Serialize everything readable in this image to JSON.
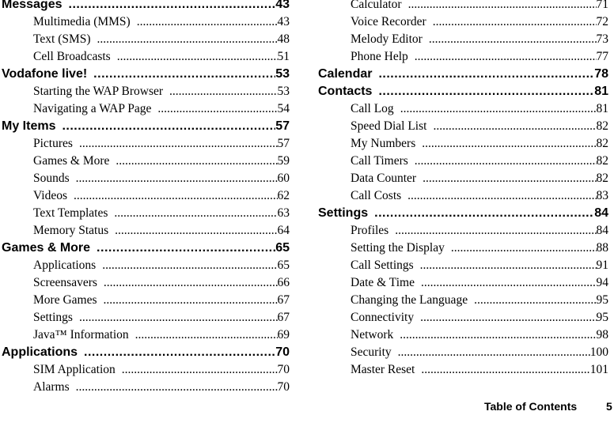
{
  "left_column": [
    {
      "type": "heading",
      "label": "Messages",
      "page": "43"
    },
    {
      "type": "sub",
      "label": "Multimedia (MMS)",
      "page": "43"
    },
    {
      "type": "sub",
      "label": "Text (SMS)",
      "page": "48"
    },
    {
      "type": "sub",
      "label": "Cell Broadcasts",
      "page": "51"
    },
    {
      "type": "heading",
      "label": "Vodafone live!",
      "page": "53"
    },
    {
      "type": "sub",
      "label": "Starting the WAP Browser",
      "page": "53"
    },
    {
      "type": "sub",
      "label": "Navigating a WAP Page",
      "page": "54"
    },
    {
      "type": "heading",
      "label": "My Items",
      "page": "57"
    },
    {
      "type": "sub",
      "label": "Pictures",
      "page": "57"
    },
    {
      "type": "sub",
      "label": "Games & More",
      "page": "59"
    },
    {
      "type": "sub",
      "label": "Sounds",
      "page": "60"
    },
    {
      "type": "sub",
      "label": "Videos",
      "page": "62"
    },
    {
      "type": "sub",
      "label": "Text Templates",
      "page": "63"
    },
    {
      "type": "sub",
      "label": "Memory Status",
      "page": "64"
    },
    {
      "type": "heading",
      "label": "Games & More",
      "page": "65"
    },
    {
      "type": "sub",
      "label": "Applications",
      "page": "65"
    },
    {
      "type": "sub",
      "label": "Screensavers",
      "page": "66"
    },
    {
      "type": "sub",
      "label": "More Games",
      "page": "67"
    },
    {
      "type": "sub",
      "label": "Settings",
      "page": "67"
    },
    {
      "type": "sub",
      "label": "Java™ Information",
      "page": "69"
    },
    {
      "type": "heading",
      "label": "Applications",
      "page": "70"
    },
    {
      "type": "sub",
      "label": "SIM Application",
      "page": "70"
    },
    {
      "type": "sub",
      "label": "Alarms",
      "page": "70"
    }
  ],
  "right_column": [
    {
      "type": "sub",
      "label": "Calculator",
      "page": "71"
    },
    {
      "type": "sub",
      "label": "Voice Recorder",
      "page": "72"
    },
    {
      "type": "sub",
      "label": "Melody Editor",
      "page": "73"
    },
    {
      "type": "sub",
      "label": "Phone Help",
      "page": "77"
    },
    {
      "type": "heading",
      "label": "Calendar",
      "page": "78"
    },
    {
      "type": "heading",
      "label": "Contacts",
      "page": "81"
    },
    {
      "type": "sub",
      "label": "Call Log",
      "page": "81"
    },
    {
      "type": "sub",
      "label": "Speed Dial List",
      "page": "82"
    },
    {
      "type": "sub",
      "label": "My Numbers",
      "page": "82"
    },
    {
      "type": "sub",
      "label": "Call Timers",
      "page": "82"
    },
    {
      "type": "sub",
      "label": "Data Counter",
      "page": "82"
    },
    {
      "type": "sub",
      "label": "Call Costs",
      "page": "83"
    },
    {
      "type": "heading",
      "label": "Settings",
      "page": "84"
    },
    {
      "type": "sub",
      "label": "Profiles",
      "page": "84"
    },
    {
      "type": "sub",
      "label": "Setting the Display",
      "page": "88"
    },
    {
      "type": "sub",
      "label": "Call Settings",
      "page": "91"
    },
    {
      "type": "sub",
      "label": "Date & Time",
      "page": "94"
    },
    {
      "type": "sub",
      "label": "Changing the Language",
      "page": "95"
    },
    {
      "type": "sub",
      "label": "Connectivity",
      "page": "95"
    },
    {
      "type": "sub",
      "label": "Network",
      "page": "98"
    },
    {
      "type": "sub",
      "label": "Security",
      "page": "100"
    },
    {
      "type": "sub",
      "label": "Master Reset",
      "page": "101"
    }
  ],
  "footer": {
    "title": "Table of Contents",
    "page_number": "5"
  }
}
